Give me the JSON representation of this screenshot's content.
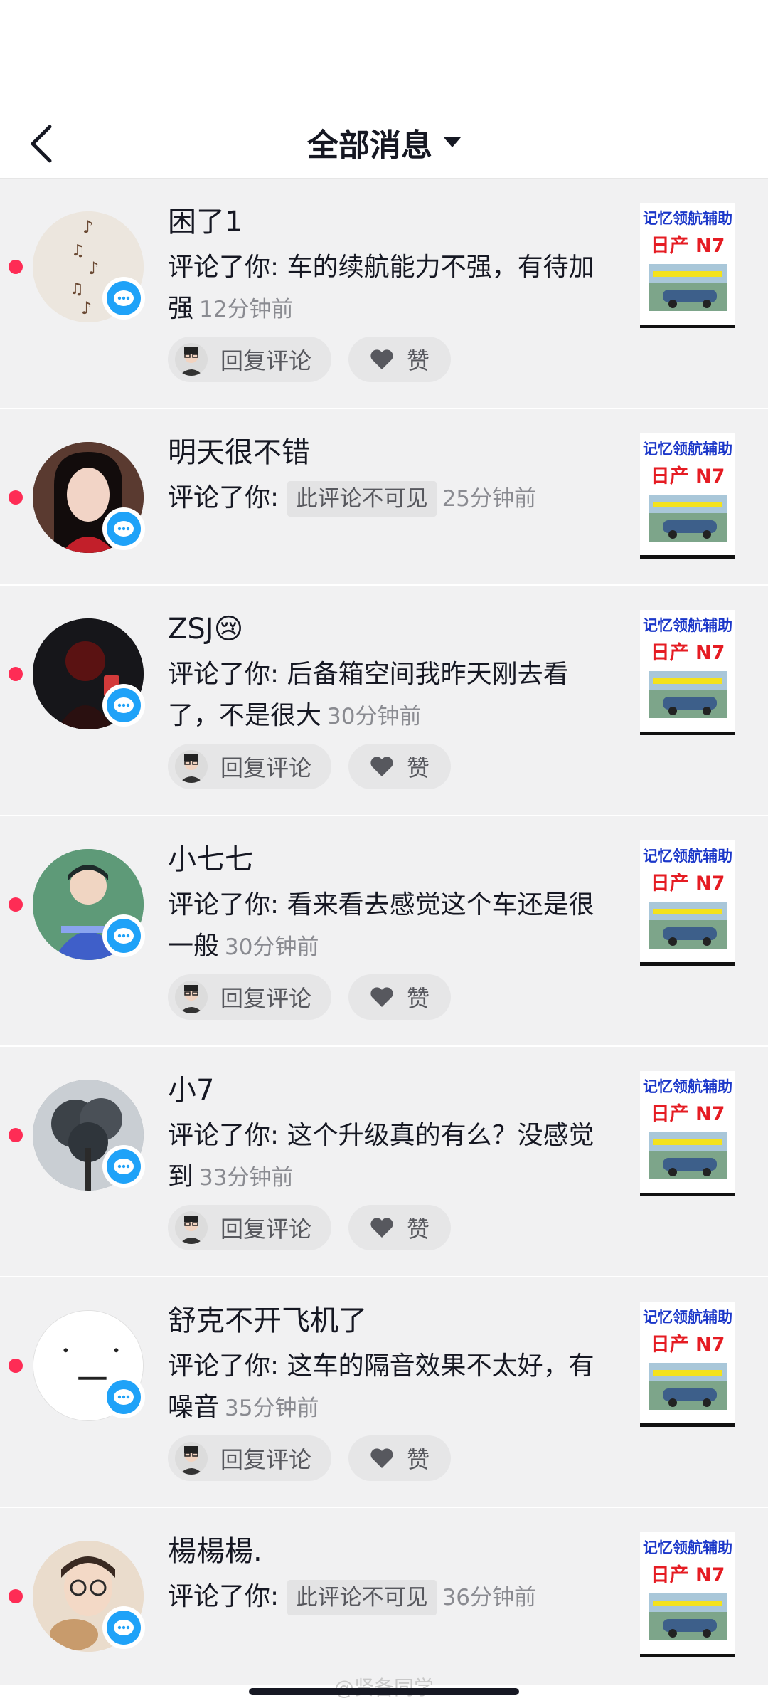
{
  "header": {
    "title": "全部消息"
  },
  "items": [
    {
      "name": "困了1",
      "prefix": "评论了你: ",
      "comment": "车的续航能力不强，有待加强",
      "time": "12分钟前",
      "reply_label": "回复评论",
      "like_label": "赞",
      "thumb_top": "记忆领航辅助",
      "thumb_mid": "日产 N7"
    },
    {
      "name": "明天很不错",
      "prefix": "评论了你: ",
      "hidden_tag": "此评论不可见",
      "time": "25分钟前",
      "thumb_top": "记忆领航辅助",
      "thumb_mid": "日产 N7"
    },
    {
      "name": "ZSJ😢",
      "prefix": "评论了你: ",
      "comment": "后备箱空间我昨天刚去看了，不是很大",
      "time": "30分钟前",
      "reply_label": "回复评论",
      "like_label": "赞",
      "thumb_top": "记忆领航辅助",
      "thumb_mid": "日产 N7"
    },
    {
      "name": "小七七",
      "prefix": "评论了你: ",
      "comment": "看来看去感觉这个车还是很一般",
      "time": "30分钟前",
      "reply_label": "回复评论",
      "like_label": "赞",
      "thumb_top": "记忆领航辅助",
      "thumb_mid": "日产 N7"
    },
    {
      "name": "小7",
      "prefix": "评论了你: ",
      "comment": "这个升级真的有么？没感觉到",
      "time": "33分钟前",
      "reply_label": "回复评论",
      "like_label": "赞",
      "thumb_top": "记忆领航辅助",
      "thumb_mid": "日产 N7"
    },
    {
      "name": "舒克不开飞机了",
      "prefix": "评论了你: ",
      "comment": "这车的隔音效果不太好，有噪音",
      "time": "35分钟前",
      "reply_label": "回复评论",
      "like_label": "赞",
      "thumb_top": "记忆领航辅助",
      "thumb_mid": "日产 N7"
    },
    {
      "name": "楊楊楊.",
      "prefix": "评论了你: ",
      "hidden_tag": "此评论不可见",
      "time": "36分钟前",
      "thumb_top": "记忆领航辅助",
      "thumb_mid": "日产 N7"
    }
  ],
  "watermark": "@贤备同学",
  "colors": {
    "unread_dot": "#fe2c55",
    "badge": "#1fa2f8",
    "list_bg": "#f1f1f2"
  }
}
